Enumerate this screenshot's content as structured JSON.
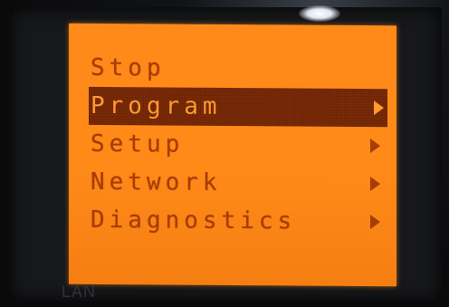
{
  "display": {
    "menu_items": [
      {
        "label": "Stop",
        "selected": false,
        "has_submenu": false
      },
      {
        "label": "Program",
        "selected": true,
        "has_submenu": true
      },
      {
        "label": "Setup",
        "selected": false,
        "has_submenu": true
      },
      {
        "label": "Network",
        "selected": false,
        "has_submenu": true
      },
      {
        "label": "Diagnostics",
        "selected": false,
        "has_submenu": true
      }
    ],
    "colors": {
      "screen_backlight": "#ff8a1a",
      "text": "#a63c06",
      "highlight_bar": "#7a2a06"
    }
  },
  "device": {
    "panel_label": "LAN"
  }
}
